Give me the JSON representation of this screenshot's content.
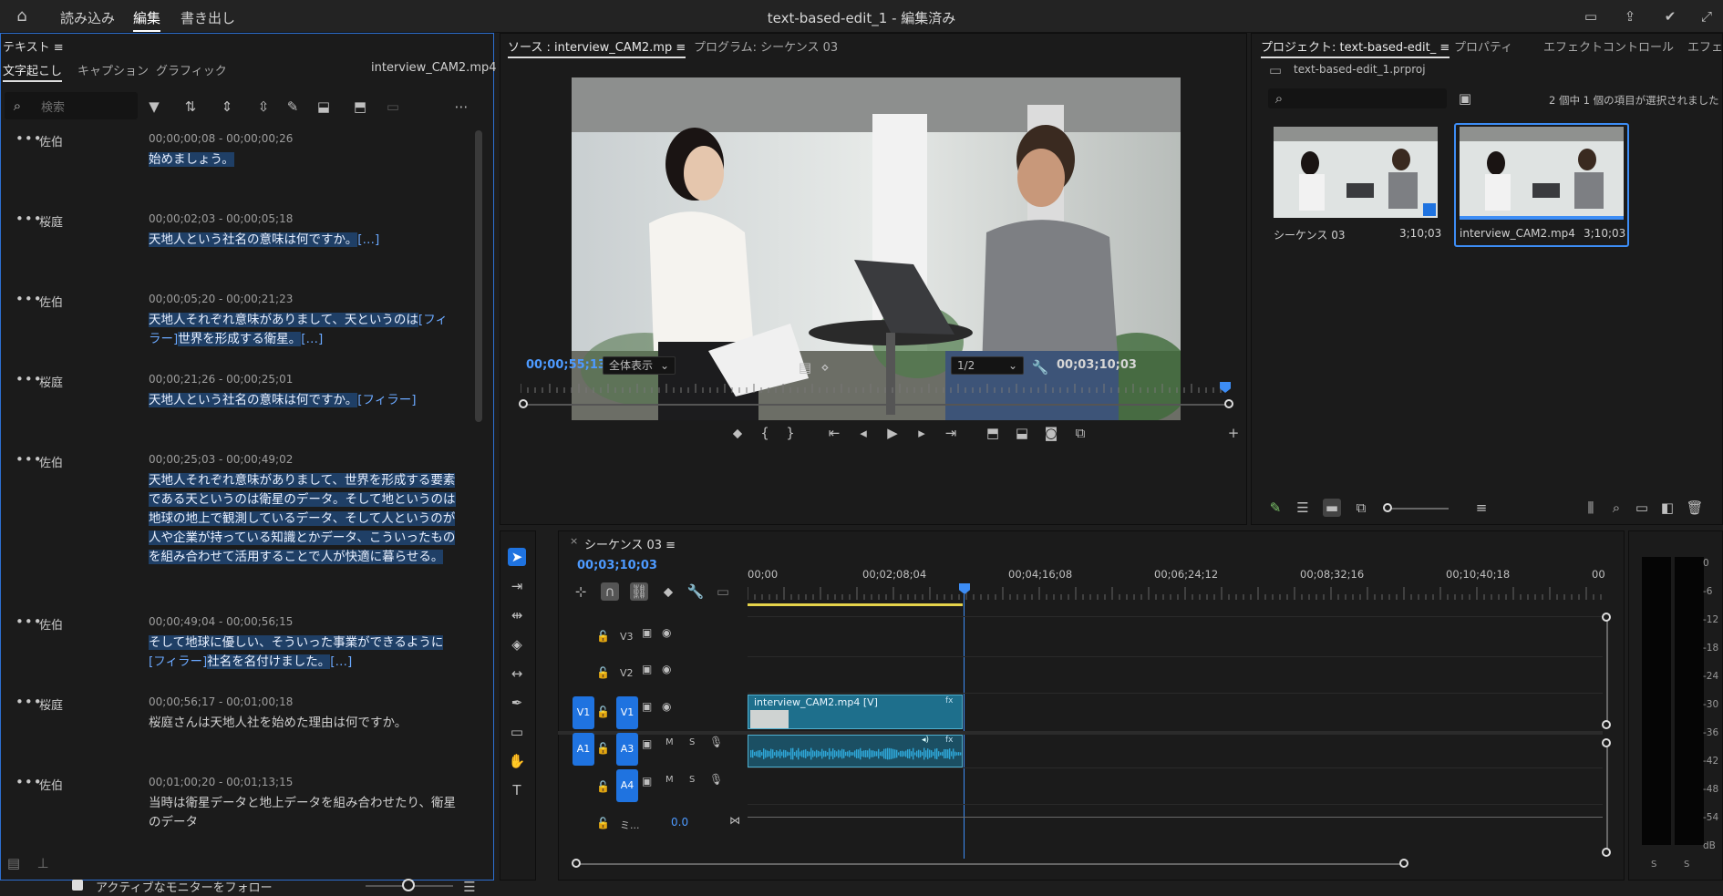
{
  "app": {
    "title": "text-based-edit_1 - 編集済み",
    "menu": [
      "読み込み",
      "編集",
      "書き出し"
    ],
    "active_menu": "編集"
  },
  "text_panel": {
    "header": "テキスト ≡",
    "tabs": [
      "文字起こし",
      "キャプション",
      "グラフィック"
    ],
    "active_tab": "文字起こし",
    "clip_name": "interview_CAM2.mp4",
    "search_placeholder": "検索",
    "follow_label": "アクティブなモニターをフォロー",
    "segments": [
      {
        "speaker": "佐伯",
        "timecode": "00;00;00;08 - 00;00;00;26",
        "parts": [
          {
            "t": "始めましょう。",
            "k": "hl"
          }
        ]
      },
      {
        "speaker": "桜庭",
        "timecode": "00;00;02;03 - 00;00;05;18",
        "parts": [
          {
            "t": "天地人という社名の意味は何ですか。",
            "k": "hl"
          },
          {
            "t": "[…]",
            "k": "tag"
          }
        ]
      },
      {
        "speaker": "佐伯",
        "timecode": "00;00;05;20 - 00;00;21;23",
        "parts": [
          {
            "t": "天地人それぞれ意味がありまして、天というのは",
            "k": "hl"
          },
          {
            "t": "[フィラー]",
            "k": "tag"
          },
          {
            "t": "世界を形成する衛星。",
            "k": "hl"
          },
          {
            "t": "[…]",
            "k": "tag"
          }
        ]
      },
      {
        "speaker": "桜庭",
        "timecode": "00;00;21;26 - 00;00;25;01",
        "parts": [
          {
            "t": "天地人という社名の意味は何ですか。",
            "k": "hl"
          },
          {
            "t": "[フィラー]",
            "k": "tag"
          }
        ]
      },
      {
        "speaker": "佐伯",
        "timecode": "00;00;25;03 - 00;00;49;02",
        "parts": [
          {
            "t": "天地人それぞれ意味がありまして、世界を形成する要素である天というのは衛星のデータ。そして地というのは地球の地上で観測しているデータ、そして人というのが人や企業が持っている知識とかデータ、こういったものを組み合わせて活用することで人が快適に暮らせる。",
            "k": "hl"
          }
        ]
      },
      {
        "speaker": "佐伯",
        "timecode": "00;00;49;04 - 00;00;56;15",
        "parts": [
          {
            "t": "そして地球に優しい、そういった事業ができるように",
            "k": "hl"
          },
          {
            "t": "[フィラー]",
            "k": "tag"
          },
          {
            "t": "社名を名付けました。",
            "k": "hl"
          },
          {
            "t": "[…]",
            "k": "tag"
          }
        ]
      },
      {
        "speaker": "桜庭",
        "timecode": "00;00;56;17 - 00;01;00;18",
        "parts": [
          {
            "t": "桜庭さんは天地人社を始めた理由は何ですか。",
            "k": "plain"
          }
        ]
      },
      {
        "speaker": "佐伯",
        "timecode": "00;01;00;20 - 00;01;13;15",
        "parts": [
          {
            "t": "当時は衛星データと地上データを組み合わせたり、衛星のデータ",
            "k": "plain"
          }
        ]
      }
    ]
  },
  "monitor": {
    "tab_source": "ソース : interview_CAM2.mp ≡",
    "tab_program": "プログラム: シーケンス 03",
    "current_time": "00;00;55;13",
    "fit": "全体表示",
    "resolution": "1/2",
    "duration": "00;03;10;03",
    "playhead_fraction": 0.29
  },
  "project": {
    "tabs": [
      "プロジェクト: text-based-edit_ ≡",
      "プロパティ",
      "エフェクトコントロール",
      "エフェ"
    ],
    "file": "text-based-edit_1.prproj",
    "selection_status": "2 個中 1 個の項目が選択されました",
    "items": [
      {
        "name": "シーケンス 03",
        "duration": "3;10;03",
        "selected": false
      },
      {
        "name": "interview_CAM2.mp4",
        "duration": "3;10;03",
        "selected": true
      }
    ]
  },
  "timeline": {
    "sequence": "シーケンス 03 ≡",
    "timecode": "00;03;10;03",
    "ruler": [
      "00;00",
      "00;02;08;04",
      "00;04;16;08",
      "00;06;24;12",
      "00;08;32;16",
      "00;10;40;18",
      "00"
    ],
    "tracks": {
      "V3": "V3",
      "V2": "V2",
      "V1": "V1",
      "A1": "A1",
      "A3": "A3",
      "A4": "A4",
      "mix": "ミ...",
      "mix_value": "0.0",
      "mute": "M",
      "solo": "S"
    },
    "clip_video": "interview_CAM2.mp4 [V]",
    "clip_fx": "fx"
  },
  "meter": {
    "labels": [
      "0",
      "-6",
      "-12",
      "-18",
      "-24",
      "-30",
      "-36",
      "-42",
      "-48",
      "-54",
      "dB"
    ],
    "channels": [
      "S",
      "S"
    ]
  },
  "colors": {
    "accent": "#2d6fd1",
    "highlight": "#1f3f66",
    "clip": "#1e6f8c",
    "audio": "#2fa7d8"
  }
}
